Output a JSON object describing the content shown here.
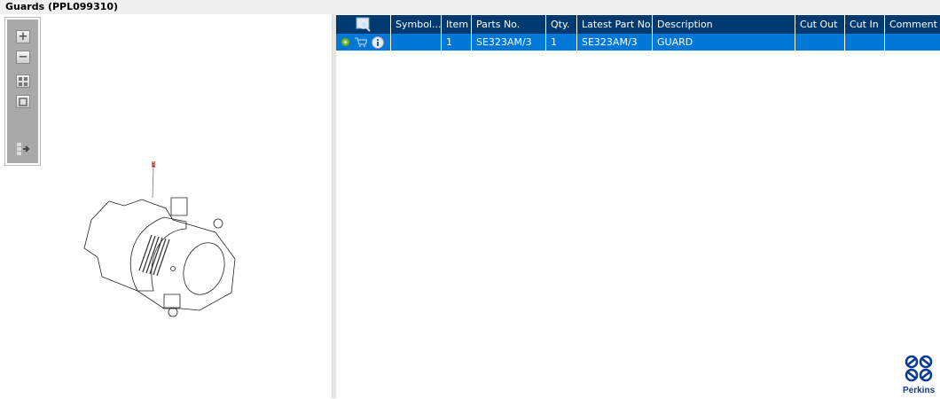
{
  "title": "Guards (PPL099310)",
  "toolbar": {
    "zoom_in_icon": "zoom-in-icon",
    "zoom_out_icon": "zoom-out-icon",
    "fit_icon": "fit-all-icon",
    "actual_size_icon": "actual-size-icon",
    "export_icon": "export-icon"
  },
  "drawing": {
    "callout": "1"
  },
  "table": {
    "columns": [
      "",
      "Symbol...",
      "Item",
      "Parts No.",
      "Qty.",
      "Latest Part No.",
      "Description",
      "Cut Out",
      "Cut In",
      "Comment"
    ],
    "rows": [
      {
        "symbol": "",
        "item": "1",
        "parts_no": "SE323AM/3",
        "qty": "1",
        "latest_part_no": "SE323AM/3",
        "description": "GUARD",
        "cut_out": "",
        "cut_in": "",
        "comment": ""
      }
    ]
  },
  "brand": {
    "name": "Perkins",
    "color": "#0a3d91"
  },
  "colors": {
    "header": "#003a70",
    "selected_row": "#0078d7"
  }
}
